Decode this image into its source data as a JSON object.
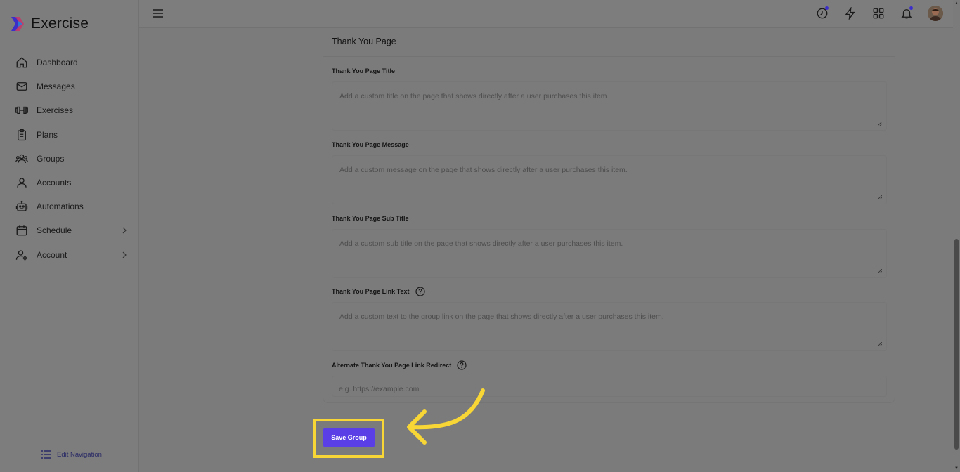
{
  "app": {
    "name": "Exercise"
  },
  "sidebar": {
    "items": [
      {
        "label": "Dashboard",
        "icon": "home-icon"
      },
      {
        "label": "Messages",
        "icon": "mail-icon"
      },
      {
        "label": "Exercises",
        "icon": "dumbbell-icon"
      },
      {
        "label": "Plans",
        "icon": "clipboard-icon"
      },
      {
        "label": "Groups",
        "icon": "users-icon"
      },
      {
        "label": "Accounts",
        "icon": "user-icon"
      },
      {
        "label": "Automations",
        "icon": "robot-icon"
      },
      {
        "label": "Schedule",
        "icon": "calendar-icon",
        "has_submenu": true
      },
      {
        "label": "Account",
        "icon": "user-settings-icon",
        "has_submenu": true
      }
    ],
    "edit_navigation": "Edit Navigation"
  },
  "topbar": {
    "icons": [
      "clock-icon",
      "lightning-icon",
      "grid-icon",
      "bell-icon",
      "avatar"
    ],
    "accent": "#3b2ec9"
  },
  "section": {
    "title": "Thank You Page",
    "fields": [
      {
        "label": "Thank You Page Title",
        "placeholder": "Add a custom title on the page that shows directly after a user purchases this item.",
        "help": false
      },
      {
        "label": "Thank You Page Message",
        "placeholder": "Add a custom message on the page that shows directly after a user purchases this item.",
        "help": false
      },
      {
        "label": "Thank You Page Sub Title",
        "placeholder": "Add a custom sub title on the page that shows directly after a user purchases this item.",
        "help": false
      },
      {
        "label": "Thank You Page Link Text",
        "placeholder": "Add a custom text to the group link on the page that shows directly after a user purchases this item.",
        "help": true
      }
    ],
    "redirect": {
      "label": "Alternate Thank You Page Link Redirect",
      "placeholder": "e.g. https://example.com",
      "help": true
    }
  },
  "actions": {
    "save_label": "Save Group",
    "button_color": "#5a3ee6",
    "highlight_color": "#f7d635"
  }
}
